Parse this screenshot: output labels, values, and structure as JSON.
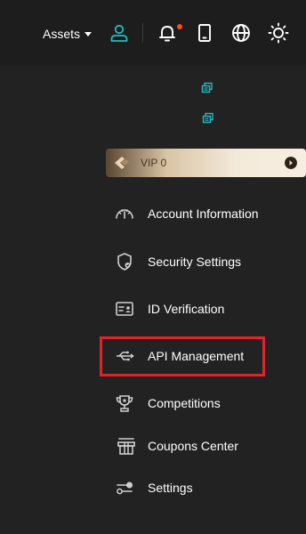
{
  "header": {
    "assets_label": "Assets",
    "icons": [
      "user-icon",
      "bell-icon",
      "mobile-icon",
      "globe-icon",
      "theme-sun-icon"
    ]
  },
  "colors": {
    "background": "#1d1d1d",
    "panel": "#222222",
    "accent_teal": "#29b8c4",
    "notification_dot": "#ff4d1c",
    "highlight": "#e0242a",
    "vip_gold": "#d8c4a4"
  },
  "vip": {
    "label": "VIP 0"
  },
  "menu": {
    "items": [
      {
        "label": "Account Information",
        "icon": "gauge-icon"
      },
      {
        "label": "Security Settings",
        "icon": "shield-icon"
      },
      {
        "label": "ID Verification",
        "icon": "id-card-icon"
      },
      {
        "label": "API Management",
        "icon": "api-icon"
      },
      {
        "label": "Competitions",
        "icon": "trophy-icon"
      },
      {
        "label": "Coupons Center",
        "icon": "gift-icon"
      },
      {
        "label": "Settings",
        "icon": "toggle-settings-icon"
      }
    ]
  }
}
